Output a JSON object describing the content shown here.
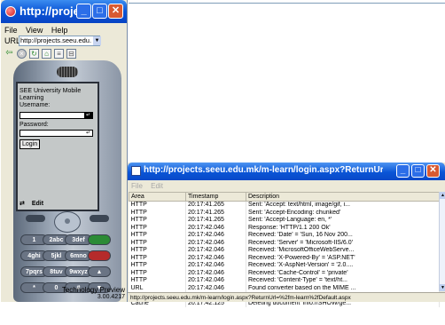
{
  "emulator": {
    "title": "http://proje...",
    "menu": [
      "File",
      "View",
      "Help"
    ],
    "url_label": "URL",
    "url_value": "http://projects.seeu.edu.",
    "screen": {
      "heading_line1": "SEE University Mobile",
      "heading_line2": "Learning",
      "username_label": "Username:",
      "password_label": "Password:",
      "login_button": "Login",
      "edit_softkey": "Edit"
    },
    "keys": [
      [
        "1",
        "2abc",
        "3def",
        ""
      ],
      [
        "4ghi",
        "5jkl",
        "6mno",
        ""
      ],
      [
        "7pqrs",
        "8tuv",
        "9wxyz",
        ""
      ],
      [
        "*",
        "0",
        "#",
        ""
      ]
    ],
    "brand": "Mobile Explorer",
    "footer_line1": "Technology Preview",
    "footer_line2": "3.00.4217"
  },
  "log": {
    "title": "http://projects.seeu.edu.mk/m-learn/login.aspx?ReturnUrl=%2fm-lear...",
    "menu": [
      "File",
      "Edit"
    ],
    "columns": [
      "Area",
      "Timestamp",
      "Description"
    ],
    "rows": [
      [
        "HTTP",
        "20:17:41.265",
        "Sent: 'Accept: text/html, image/gif, i..."
      ],
      [
        "HTTP",
        "20:17:41.265",
        "Sent: 'Accept-Encoding: chunked'"
      ],
      [
        "HTTP",
        "20:17:41.265",
        "Sent: 'Accept-Language: en, *'"
      ],
      [
        "HTTP",
        "20:17:42.046",
        "Response: 'HTTP/1.1 200 Ok'"
      ],
      [
        "HTTP",
        "20:17:42.046",
        "Received: 'Date' = 'Sun, 16 Nov 200..."
      ],
      [
        "HTTP",
        "20:17:42.046",
        "Received: 'Server' = 'Microsoft-IIS/6.0'"
      ],
      [
        "HTTP",
        "20:17:42.046",
        "Received: 'MicrosoftOfficeWebServe..."
      ],
      [
        "HTTP",
        "20:17:42.046",
        "Received: 'X-Powered-By' = 'ASP.NET'"
      ],
      [
        "HTTP",
        "20:17:42.046",
        "Received: 'X-AspNet-Version' = '2.0...."
      ],
      [
        "HTTP",
        "20:17:42.046",
        "Received: 'Cache-Control' = 'private'"
      ],
      [
        "HTTP",
        "20:17:42.046",
        "Received: 'Content-Type' = 'text/ht..."
      ],
      [
        "URL",
        "20:17:42.046",
        "Found converter based on the MIME ..."
      ],
      [
        "HTTP",
        "20:17:42.046",
        "Received: 'Content-Length' = '425'"
      ],
      [
        "Cache",
        "20:17:42.125",
        "Deleting document 'info://SHOW/ge..."
      ]
    ],
    "status": "http://projects.seeu.edu.mk/m-learn/login.aspx?ReturnUrl=%2fm-learn%2fDefault.aspx"
  },
  "colors": {
    "title_bar": "#0a55d6",
    "close_button": "#d85a32",
    "window_face": "#ece9d8"
  }
}
